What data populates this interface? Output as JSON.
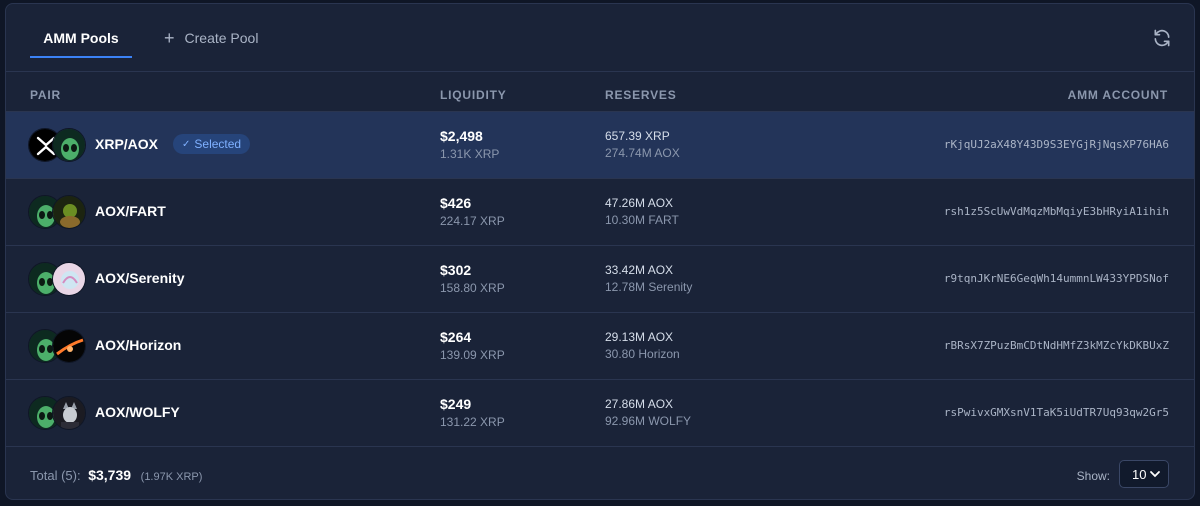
{
  "tabs": {
    "amm_pools": "AMM Pools",
    "create_pool": "Create Pool"
  },
  "columns": {
    "pair": "PAIR",
    "liquidity": "LIQUIDITY",
    "reserves": "RESERVES",
    "amm_account": "AMM ACCOUNT"
  },
  "rows": [
    {
      "pair": "XRP/AOX",
      "selected_label": "Selected",
      "liquidity_usd": "$2,498",
      "liquidity_xrp": "1.31K XRP",
      "reserve_1": "657.39 XRP",
      "reserve_2": "274.74M AOX",
      "account": "rKjqUJ2aX48Y43D9S3EYGjRjNqsXP76HA6"
    },
    {
      "pair": "AOX/FART",
      "liquidity_usd": "$426",
      "liquidity_xrp": "224.17 XRP",
      "reserve_1": "47.26M AOX",
      "reserve_2": "10.30M FART",
      "account": "rsh1z5ScUwVdMqzMbMqiyE3bHRyiA1ihih"
    },
    {
      "pair": "AOX/Serenity",
      "liquidity_usd": "$302",
      "liquidity_xrp": "158.80 XRP",
      "reserve_1": "33.42M AOX",
      "reserve_2": "12.78M Serenity",
      "account": "r9tqnJKrNE6GeqWh14ummnLW433YPDSNof"
    },
    {
      "pair": "AOX/Horizon",
      "liquidity_usd": "$264",
      "liquidity_xrp": "139.09 XRP",
      "reserve_1": "29.13M AOX",
      "reserve_2": "30.80 Horizon",
      "account": "rBRsX7ZPuzBmCDtNdHMfZ3kMZcYkDKBUxZ"
    },
    {
      "pair": "AOX/WOLFY",
      "liquidity_usd": "$249",
      "liquidity_xrp": "131.22 XRP",
      "reserve_1": "27.86M AOX",
      "reserve_2": "92.96M WOLFY",
      "account": "rsPwivxGMXsnV1TaK5iUdTR7Uq93qw2Gr5"
    }
  ],
  "footer": {
    "total_label": "Total (5):",
    "total_usd": "$3,739",
    "total_xrp": "(1.97K XRP)",
    "show_label": "Show:",
    "show_value": "10"
  },
  "icons": {
    "refresh": "refresh-icon",
    "plus": "plus-icon",
    "check": "check-icon",
    "chevron": "chevron-down-icon"
  },
  "colors": {
    "accent": "#3b82f6",
    "selected_row": "#233459",
    "panel": "#1a2338"
  }
}
